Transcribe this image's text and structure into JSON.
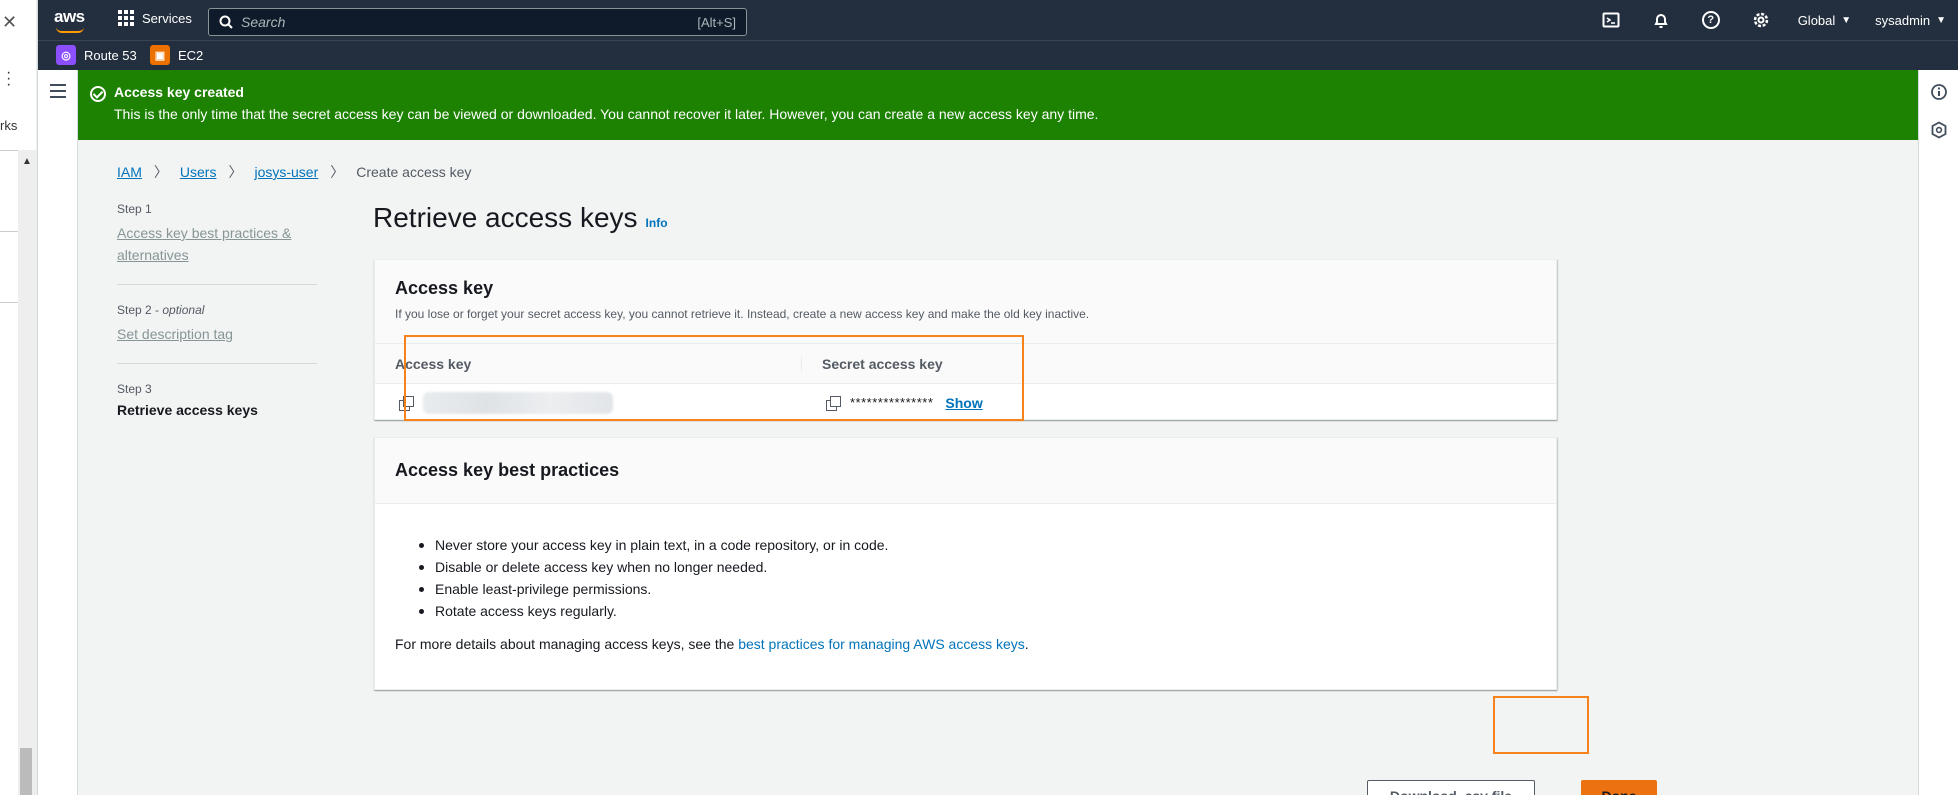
{
  "sliver": {
    "close": "✕",
    "text": "rks",
    "arrow": "▲"
  },
  "nav": {
    "logo": "aws",
    "services_label": "Services",
    "search_placeholder": "Search",
    "search_shortcut": "[Alt+S]",
    "region_label": "Global",
    "user_label": "sysadmin"
  },
  "favorites": [
    {
      "label": "Route 53",
      "color": "#8c4fff"
    },
    {
      "label": "EC2",
      "color": "#ed7100"
    }
  ],
  "flash": {
    "title": "Access key created",
    "message": "This is the only time that the secret access key can be viewed or downloaded. You cannot recover it later. However, you can create a new access key any time."
  },
  "breadcrumb": {
    "iam": "IAM",
    "users": "Users",
    "user": "josys-user",
    "current": "Create access key"
  },
  "steps": {
    "s1": {
      "num": "Step 1",
      "label": "Access key best practices & alternatives"
    },
    "s2": {
      "num": "Step 2",
      "optional": "optional",
      "label": "Set description tag"
    },
    "s3": {
      "num": "Step 3",
      "label": "Retrieve access keys"
    }
  },
  "page_title": "Retrieve access keys",
  "info_link": "Info",
  "access_key_card": {
    "title": "Access key",
    "description": "If you lose or forget your secret access key, you cannot retrieve it. Instead, create a new access key and make the old key inactive.",
    "col_access_key": "Access key",
    "col_secret": "Secret access key",
    "secret_masked": "***************",
    "show_label": "Show"
  },
  "best_practices_card": {
    "title": "Access key best practices",
    "items": [
      "Never store your access key in plain text, in a code repository, or in code.",
      "Disable or delete access key when no longer needed.",
      "Enable least-privilege permissions.",
      "Rotate access keys regularly."
    ],
    "more_prefix": "For more details about managing access keys, see the ",
    "more_link": "best practices for managing AWS access keys",
    "more_suffix": "."
  },
  "buttons": {
    "download_csv": "Download .csv file",
    "done": "Done"
  },
  "colors": {
    "nav_bg": "#232f3e",
    "success": "#1d8102",
    "link": "#0073bb",
    "primary": "#ec7211",
    "highlight": "#f7821b"
  }
}
